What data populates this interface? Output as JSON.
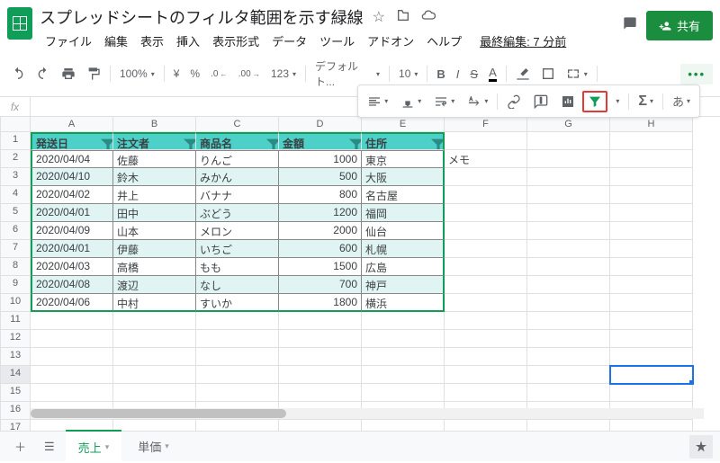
{
  "doc": {
    "title": "スプレッドシートのフィルタ範囲を示す緑線"
  },
  "menus": {
    "file": "ファイル",
    "edit": "編集",
    "view": "表示",
    "insert": "挿入",
    "format": "表示形式",
    "data": "データ",
    "tools": "ツール",
    "addons": "アドオン",
    "help": "ヘルプ",
    "last_edit": "最終編集: 7 分前"
  },
  "share": {
    "label": "共有"
  },
  "toolbar": {
    "zoom": "100%",
    "currency": "¥",
    "percent": "%",
    "dec_dec": ".0←",
    "dec_inc": ".00→",
    "more_fmt": "123",
    "font": "デフォルト...",
    "font_size": "10",
    "bold": "B",
    "italic": "I",
    "strike": "S",
    "color_letter": "A",
    "japanese": "あ"
  },
  "columns": [
    "A",
    "B",
    "C",
    "D",
    "E",
    "F",
    "G",
    "H"
  ],
  "headers": [
    "発送日",
    "注文者",
    "商品名",
    "金額",
    "住所"
  ],
  "memo": "メモ",
  "rows": [
    {
      "d": "2020/04/04",
      "o": "佐藤",
      "p": "りんご",
      "a": "1000",
      "addr": "東京"
    },
    {
      "d": "2020/04/10",
      "o": "鈴木",
      "p": "みかん",
      "a": "500",
      "addr": "大阪"
    },
    {
      "d": "2020/04/02",
      "o": "井上",
      "p": "バナナ",
      "a": "800",
      "addr": "名古屋"
    },
    {
      "d": "2020/04/01",
      "o": "田中",
      "p": "ぶどう",
      "a": "1200",
      "addr": "福岡"
    },
    {
      "d": "2020/04/09",
      "o": "山本",
      "p": "メロン",
      "a": "2000",
      "addr": "仙台"
    },
    {
      "d": "2020/04/01",
      "o": "伊藤",
      "p": "いちご",
      "a": "600",
      "addr": "札幌"
    },
    {
      "d": "2020/04/03",
      "o": "高橋",
      "p": "もも",
      "a": "1500",
      "addr": "広島"
    },
    {
      "d": "2020/04/08",
      "o": "渡辺",
      "p": "なし",
      "a": "700",
      "addr": "神戸"
    },
    {
      "d": "2020/04/06",
      "o": "中村",
      "p": "すいか",
      "a": "1800",
      "addr": "横浜"
    }
  ],
  "sheets": {
    "active": "売上",
    "other": "単価"
  },
  "selected_cell": {
    "col": "H",
    "row": 14
  }
}
